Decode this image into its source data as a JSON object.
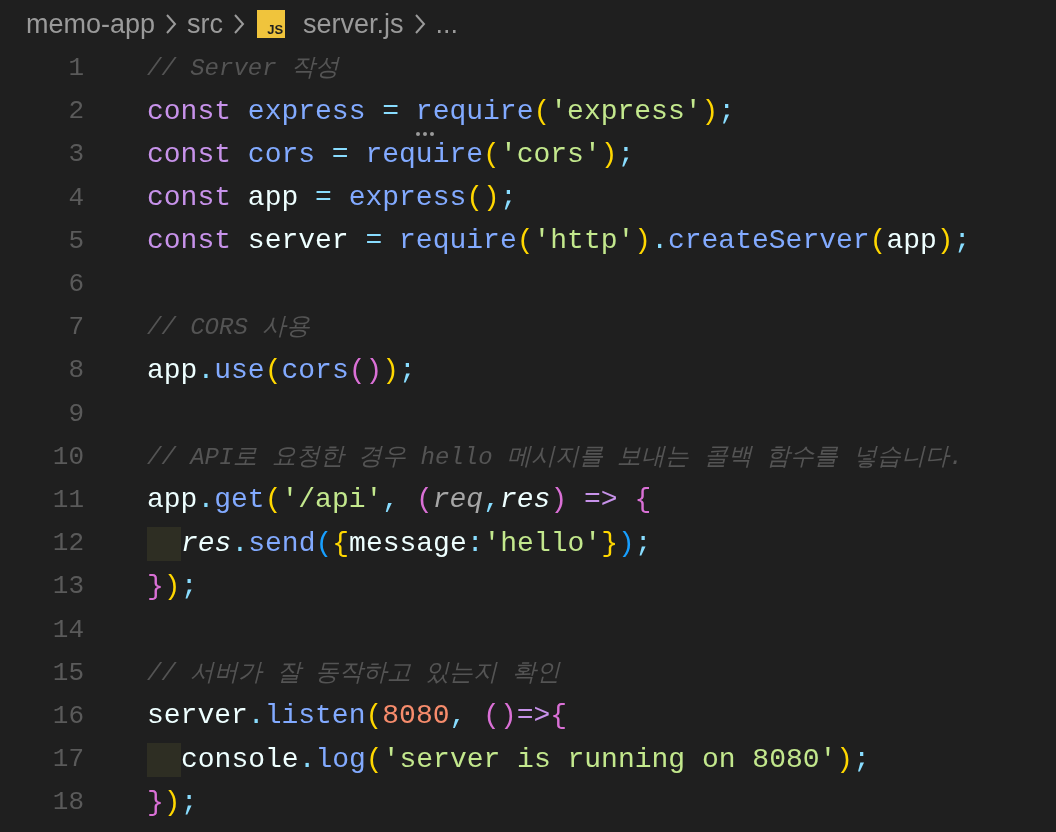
{
  "breadcrumb": [
    {
      "kind": "folder",
      "label": "memo-app"
    },
    {
      "kind": "folder",
      "label": "src"
    },
    {
      "kind": "file",
      "label": "server.js",
      "icon_text": "JS"
    },
    {
      "kind": "more",
      "label": "..."
    }
  ],
  "editor": {
    "lines": [
      {
        "number": "1",
        "tokens": [
          {
            "kind": "comment",
            "text": "// Server 작성"
          }
        ]
      },
      {
        "number": "2",
        "tokens": [
          {
            "kind": "keyword",
            "text": "const "
          },
          {
            "kind": "function",
            "text": "express "
          },
          {
            "kind": "punct",
            "text": "= "
          },
          {
            "kind": "function",
            "text": "require",
            "hint": true
          },
          {
            "kind": "bracket1",
            "text": "("
          },
          {
            "kind": "string",
            "text": "'express'"
          },
          {
            "kind": "bracket1",
            "text": ")"
          },
          {
            "kind": "punct",
            "text": ";"
          }
        ]
      },
      {
        "number": "3",
        "tokens": [
          {
            "kind": "keyword",
            "text": "const "
          },
          {
            "kind": "function",
            "text": "cors "
          },
          {
            "kind": "punct",
            "text": "= "
          },
          {
            "kind": "function",
            "text": "require"
          },
          {
            "kind": "bracket1",
            "text": "("
          },
          {
            "kind": "string",
            "text": "'cors'"
          },
          {
            "kind": "bracket1",
            "text": ")"
          },
          {
            "kind": "punct",
            "text": ";"
          }
        ]
      },
      {
        "number": "4",
        "tokens": [
          {
            "kind": "keyword",
            "text": "const "
          },
          {
            "kind": "plain",
            "text": "app "
          },
          {
            "kind": "punct",
            "text": "= "
          },
          {
            "kind": "function",
            "text": "express"
          },
          {
            "kind": "bracket1",
            "text": "()"
          },
          {
            "kind": "punct",
            "text": ";"
          }
        ]
      },
      {
        "number": "5",
        "tokens": [
          {
            "kind": "keyword",
            "text": "const "
          },
          {
            "kind": "plain",
            "text": "server "
          },
          {
            "kind": "punct",
            "text": "= "
          },
          {
            "kind": "function",
            "text": "require"
          },
          {
            "kind": "bracket1",
            "text": "("
          },
          {
            "kind": "string",
            "text": "'http'"
          },
          {
            "kind": "bracket1",
            "text": ")"
          },
          {
            "kind": "punct",
            "text": "."
          },
          {
            "kind": "function",
            "text": "createServer"
          },
          {
            "kind": "bracket1",
            "text": "("
          },
          {
            "kind": "plain",
            "text": "app"
          },
          {
            "kind": "bracket1",
            "text": ")"
          },
          {
            "kind": "punct",
            "text": ";"
          }
        ]
      },
      {
        "number": "6"
      },
      {
        "number": "7",
        "tokens": [
          {
            "kind": "comment",
            "text": "// CORS 사용"
          }
        ]
      },
      {
        "number": "8",
        "tokens": [
          {
            "kind": "plain",
            "text": "app"
          },
          {
            "kind": "punct",
            "text": "."
          },
          {
            "kind": "function",
            "text": "use"
          },
          {
            "kind": "bracket1",
            "text": "("
          },
          {
            "kind": "function",
            "text": "cors"
          },
          {
            "kind": "bracket2",
            "text": "()"
          },
          {
            "kind": "bracket1",
            "text": ")"
          },
          {
            "kind": "punct",
            "text": ";"
          }
        ]
      },
      {
        "number": "9"
      },
      {
        "number": "10",
        "tokens": [
          {
            "kind": "comment",
            "text": "// API로 요청한 경우 hello 메시지를 보내는 콜백 함수를 넣습니다."
          }
        ]
      },
      {
        "number": "11",
        "tokens": [
          {
            "kind": "plain",
            "text": "app"
          },
          {
            "kind": "punct",
            "text": "."
          },
          {
            "kind": "function",
            "text": "get"
          },
          {
            "kind": "bracket1",
            "text": "("
          },
          {
            "kind": "string",
            "text": "'/api'"
          },
          {
            "kind": "punct",
            "text": ", "
          },
          {
            "kind": "bracket2",
            "text": "("
          },
          {
            "kind": "param",
            "text": "req"
          },
          {
            "kind": "punct",
            "text": ","
          },
          {
            "kind": "param_used",
            "text": "res"
          },
          {
            "kind": "bracket2",
            "text": ")"
          },
          {
            "kind": "keyword",
            "text": " => "
          },
          {
            "kind": "bracket2",
            "text": "{"
          }
        ]
      },
      {
        "number": "12",
        "indent": true,
        "tokens": [
          {
            "kind": "param_used",
            "text": "res"
          },
          {
            "kind": "punct",
            "text": "."
          },
          {
            "kind": "function",
            "text": "send"
          },
          {
            "kind": "bracket3",
            "text": "("
          },
          {
            "kind": "bracket1",
            "text": "{"
          },
          {
            "kind": "plain",
            "text": "message"
          },
          {
            "kind": "punct",
            "text": ":"
          },
          {
            "kind": "string",
            "text": "'hello'"
          },
          {
            "kind": "bracket1",
            "text": "}"
          },
          {
            "kind": "bracket3",
            "text": ")"
          },
          {
            "kind": "punct",
            "text": ";"
          }
        ]
      },
      {
        "number": "13",
        "tokens": [
          {
            "kind": "bracket2",
            "text": "}"
          },
          {
            "kind": "bracket1",
            "text": ")"
          },
          {
            "kind": "punct",
            "text": ";"
          }
        ]
      },
      {
        "number": "14"
      },
      {
        "number": "15",
        "tokens": [
          {
            "kind": "comment",
            "text": "// 서버가 잘 동작하고 있는지 확인"
          }
        ]
      },
      {
        "number": "16",
        "tokens": [
          {
            "kind": "plain",
            "text": "server"
          },
          {
            "kind": "punct",
            "text": "."
          },
          {
            "kind": "function",
            "text": "listen"
          },
          {
            "kind": "bracket1",
            "text": "("
          },
          {
            "kind": "number",
            "text": "8080"
          },
          {
            "kind": "punct",
            "text": ", "
          },
          {
            "kind": "bracket2",
            "text": "()"
          },
          {
            "kind": "keyword",
            "text": "=>"
          },
          {
            "kind": "bracket2",
            "text": "{"
          }
        ]
      },
      {
        "number": "17",
        "indent": true,
        "tokens": [
          {
            "kind": "plain",
            "text": "console"
          },
          {
            "kind": "punct",
            "text": "."
          },
          {
            "kind": "function",
            "text": "log"
          },
          {
            "kind": "bracket1",
            "text": "("
          },
          {
            "kind": "string",
            "text": "'server is running on 8080'"
          },
          {
            "kind": "bracket1",
            "text": ")"
          },
          {
            "kind": "punct",
            "text": ";"
          }
        ]
      },
      {
        "number": "18",
        "tokens": [
          {
            "kind": "bracket2",
            "text": "}"
          },
          {
            "kind": "bracket1",
            "text": ")"
          },
          {
            "kind": "punct",
            "text": ";"
          }
        ]
      }
    ]
  }
}
